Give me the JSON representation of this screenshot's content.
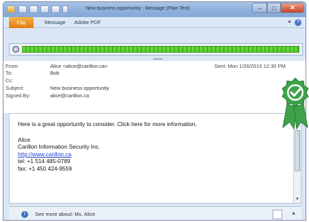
{
  "window": {
    "title": "New business opportunity - Message (Plain Text)"
  },
  "ribbon": {
    "file": "File",
    "message": "Message",
    "pdf": "Adobe PDF"
  },
  "banner": {
    "progress": 1.0
  },
  "headers": {
    "from_label": "From:",
    "from_value": "Alice <alice@carillon.ca>",
    "to_label": "To:",
    "to_value": "Bob",
    "cc_label": "Cc:",
    "cc_value": "",
    "subject_label": "Subject:",
    "subject_value": "New business opportunity",
    "signed_label": "Signed By:",
    "signed_value": "alice@carillon.ca",
    "sent_label": "Sent:",
    "sent_value": "Mon 1/26/2015 12:30 PM"
  },
  "body": {
    "intro": "Here is a great opportunity to consider. Click here for more information.",
    "sig_name": "Alice",
    "sig_company": "Carillon Information Security Inc.",
    "sig_url": "http://www.carillon.ca",
    "sig_tel": "tel: +1 514 485-0789",
    "sig_fax": "fax: +1 450 424-9559"
  },
  "people_pane": {
    "text": "See more about: Ms. Alice"
  },
  "colors": {
    "accent": "#e07a13",
    "verified_badge": "#3fa24a",
    "link": "#1a3fd0"
  },
  "icons": {
    "banner": "globe-icon",
    "badge": "verified-checkmark-icon",
    "people": "info-icon"
  }
}
